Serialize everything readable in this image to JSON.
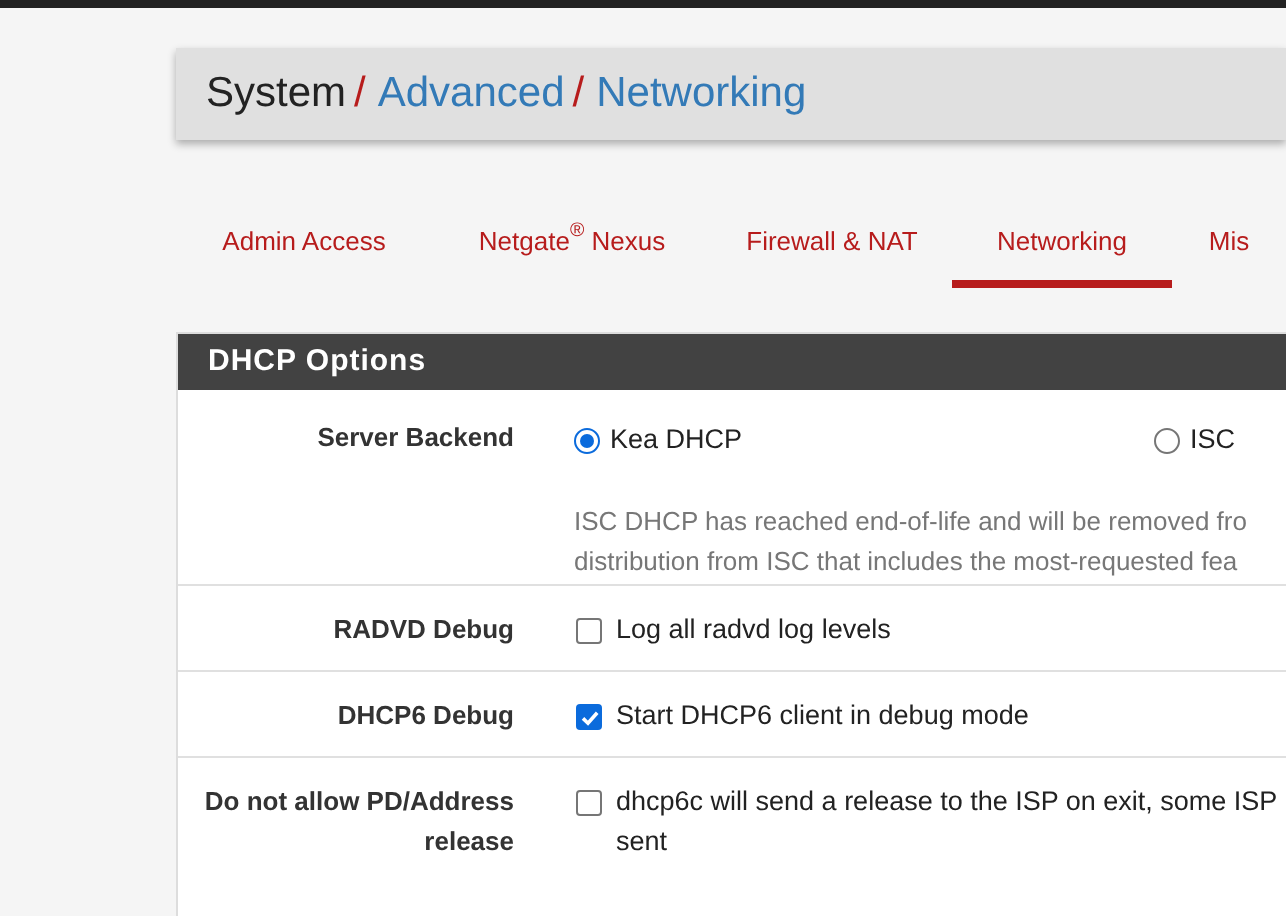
{
  "breadcrumb": [
    {
      "label": "System",
      "link": false
    },
    {
      "sep": "/",
      "label": "Advanced",
      "link": true
    },
    {
      "sep": "/",
      "label": "Networking",
      "link": true
    }
  ],
  "tabs": [
    {
      "label": "Admin Access",
      "selected": false
    },
    {
      "label": "Netgate",
      "sup": "®",
      "after": " Nexus",
      "selected": false
    },
    {
      "label": "Firewall & NAT",
      "selected": false
    },
    {
      "label": "Networking",
      "selected": true
    },
    {
      "label": "Mis",
      "selected": false
    }
  ],
  "panel": {
    "title": "DHCP Options",
    "rows": [
      {
        "kind": "radio",
        "label": "Server Backend",
        "options": [
          {
            "label": "Kea DHCP",
            "selected": true
          },
          {
            "label": "ISC",
            "selected": false
          }
        ],
        "help_lines": [
          "ISC DHCP has reached end-of-life and will be removed fro",
          "distribution from ISC that includes the most-requested fea"
        ]
      },
      {
        "kind": "checkbox",
        "label": "RADVD Debug",
        "checked": false,
        "text_lines": [
          "Log all radvd log levels"
        ]
      },
      {
        "kind": "checkbox",
        "label": "DHCP6 Debug",
        "checked": true,
        "text_lines": [
          "Start DHCP6 client in debug mode"
        ]
      },
      {
        "kind": "checkbox",
        "label": "Do not allow PD/Address release",
        "checked": false,
        "text_lines": [
          "dhcp6c will send a release to the ISP on exit, some ISP",
          "sent"
        ]
      }
    ]
  }
}
